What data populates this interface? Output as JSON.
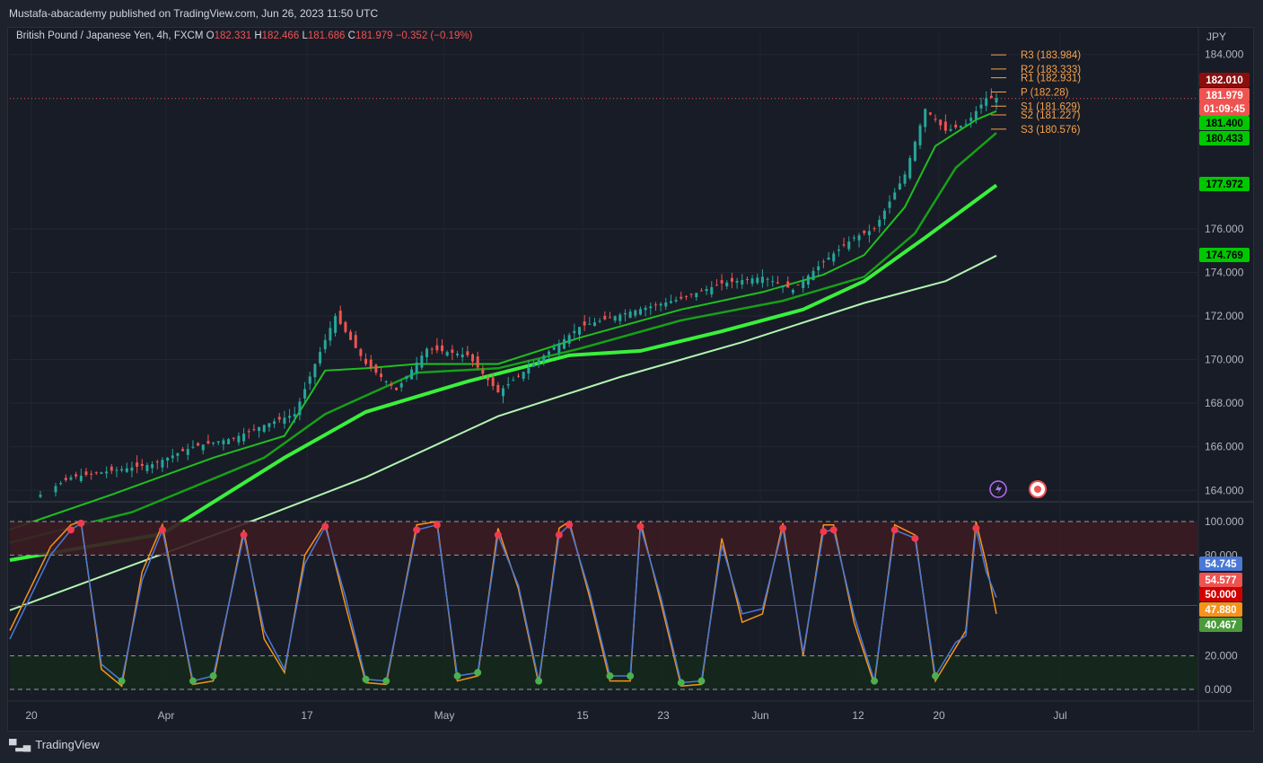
{
  "header": {
    "published": "Mustafa-abacademy published on TradingView.com, Jun 26, 2023 11:50 UTC"
  },
  "legend": {
    "symbol": "British Pound / Japanese Yen, 4h, FXCM",
    "o_label": "O",
    "o": "182.331",
    "h_label": "H",
    "h": "182.466",
    "l_label": "L",
    "l": "181.686",
    "c_label": "C",
    "c": "181.979",
    "change": "−0.352 (−0.19%)"
  },
  "footer": {
    "brand": "TradingView"
  },
  "colors": {
    "background": "#181c27",
    "up": "#26a69a",
    "down": "#ef5350",
    "ema_green": "#2fd62f",
    "sma_light": "#b2f5b2",
    "pivot": "#f7a24a",
    "stoch_k": "#4a79d6",
    "stoch_d": "#f7931a"
  },
  "chart_data": [
    {
      "type": "line",
      "title": "British Pound / Japanese Yen, 4h, FXCM",
      "currency_label": "JPY",
      "x_ticks": [
        "20",
        "Apr",
        "17",
        "May",
        "15",
        "23",
        "Jun",
        "12",
        "20",
        "Jul"
      ],
      "y_ticks": [
        "164.000",
        "166.000",
        "168.000",
        "170.000",
        "172.000",
        "174.000",
        "176.000",
        "184.000"
      ],
      "ylim": [
        163.6,
        184.4
      ],
      "price_labels": [
        {
          "value": "182.010",
          "color": "#8b0e0e"
        },
        {
          "value": "181.979",
          "color": "#ef5350"
        },
        {
          "value": "01:09:45",
          "color": "#ef5350"
        },
        {
          "value": "181.400",
          "color": "#00c800"
        },
        {
          "value": "180.433",
          "color": "#00c800"
        },
        {
          "value": "177.972",
          "color": "#00c800"
        },
        {
          "value": "174.769",
          "color": "#00c800"
        }
      ],
      "pivots": [
        {
          "label": "R3 (183.984)",
          "value": 183.984
        },
        {
          "label": "R2 (183.333)",
          "value": 183.333
        },
        {
          "label": "R1 (182.931)",
          "value": 182.931
        },
        {
          "label": "P (182.28)",
          "value": 182.28
        },
        {
          "label": "S1 (181.629)",
          "value": 181.629
        },
        {
          "label": "S2 (181.227)",
          "value": 181.227
        },
        {
          "label": "S3 (180.576)",
          "value": 180.576
        }
      ],
      "series": [
        {
          "values": [
            [
              0,
              163.0
            ],
            [
              6,
              164.6
            ],
            [
              14,
              165.2
            ],
            [
              18,
              166.0
            ],
            [
              22,
              166.4
            ],
            [
              25,
              167.0
            ],
            [
              28,
              167.5
            ],
            [
              30,
              169.8
            ],
            [
              32,
              172.0
            ],
            [
              35,
              169.8
            ],
            [
              38,
              168.6
            ],
            [
              41,
              170.5
            ],
            [
              45,
              170.2
            ],
            [
              48,
              168.5
            ],
            [
              52,
              170.0
            ],
            [
              56,
              171.5
            ],
            [
              61,
              172.2
            ],
            [
              66,
              172.8
            ],
            [
              70,
              173.5
            ],
            [
              74,
              173.8
            ],
            [
              77,
              173.2
            ],
            [
              80,
              174.5
            ],
            [
              83,
              175.6
            ],
            [
              85,
              176.0
            ],
            [
              88,
              178.5
            ],
            [
              90,
              181.5
            ],
            [
              92,
              180.5
            ],
            [
              94,
              180.8
            ],
            [
              96,
              182.0
            ],
            [
              97,
              182.0
            ]
          ]
        },
        {
          "values": [
            [
              0,
              162.2
            ],
            [
              10,
              163.8
            ],
            [
              20,
              165.5
            ],
            [
              27,
              166.5
            ],
            [
              31,
              169.5
            ],
            [
              35,
              169.6
            ],
            [
              40,
              169.8
            ],
            [
              48,
              169.8
            ],
            [
              56,
              171.0
            ],
            [
              66,
              172.3
            ],
            [
              74,
              173.1
            ],
            [
              80,
              173.9
            ],
            [
              84,
              174.8
            ],
            [
              88,
              177.0
            ],
            [
              91,
              179.8
            ],
            [
              95,
              181.0
            ],
            [
              97,
              181.4
            ]
          ]
        },
        {
          "values": [
            [
              0,
              161.6
            ],
            [
              12,
              163.0
            ],
            [
              25,
              165.5
            ],
            [
              31,
              167.5
            ],
            [
              40,
              169.4
            ],
            [
              48,
              169.6
            ],
            [
              56,
              170.5
            ],
            [
              66,
              171.8
            ],
            [
              76,
              172.7
            ],
            [
              84,
              173.8
            ],
            [
              89,
              175.8
            ],
            [
              93,
              178.8
            ],
            [
              97,
              180.4
            ]
          ]
        },
        {
          "values": [
            [
              0,
              160.8
            ],
            [
              15,
              162.0
            ],
            [
              27,
              165.5
            ],
            [
              35,
              167.6
            ],
            [
              45,
              169.0
            ],
            [
              55,
              170.2
            ],
            [
              62,
              170.4
            ],
            [
              70,
              171.3
            ],
            [
              78,
              172.3
            ],
            [
              84,
              173.6
            ],
            [
              90,
              175.6
            ],
            [
              97,
              178.0
            ]
          ]
        },
        {
          "values": [
            [
              0,
              158.5
            ],
            [
              25,
              162.8
            ],
            [
              35,
              164.6
            ],
            [
              48,
              167.4
            ],
            [
              60,
              169.2
            ],
            [
              72,
              170.8
            ],
            [
              84,
              172.6
            ],
            [
              92,
              173.6
            ],
            [
              97,
              174.77
            ]
          ]
        }
      ]
    },
    {
      "type": "line",
      "title": "",
      "y_ticks": [
        "0.000",
        "20.000",
        "80.000",
        "100.000"
      ],
      "ylim": [
        0,
        100
      ],
      "overbought": 80,
      "oversold": 20,
      "midline": 50,
      "value_labels": [
        {
          "value": "54.745",
          "color": "#4a79d6"
        },
        {
          "value": "54.577",
          "color": "#ef5350"
        },
        {
          "value": "50.000",
          "color": "#d10000"
        },
        {
          "value": "47.880",
          "color": "#f7931a"
        },
        {
          "value": "40.467",
          "color": "#4a9b3b"
        }
      ],
      "series": [
        {
          "values": [
            [
              0,
              35
            ],
            [
              2,
              60
            ],
            [
              4,
              85
            ],
            [
              6,
              98
            ],
            [
              7,
              100
            ],
            [
              9,
              12
            ],
            [
              11,
              2
            ],
            [
              13,
              70
            ],
            [
              15,
              98
            ],
            [
              18,
              3
            ],
            [
              20,
              5
            ],
            [
              23,
              95
            ],
            [
              25,
              30
            ],
            [
              27,
              10
            ],
            [
              29,
              80
            ],
            [
              31,
              99
            ],
            [
              33,
              50
            ],
            [
              35,
              4
            ],
            [
              37,
              3
            ],
            [
              40,
              98
            ],
            [
              42,
              100
            ],
            [
              44,
              5
            ],
            [
              46,
              8
            ],
            [
              48,
              96
            ],
            [
              50,
              60
            ],
            [
              52,
              3
            ],
            [
              54,
              96
            ],
            [
              55,
              100
            ],
            [
              57,
              55
            ],
            [
              59,
              5
            ],
            [
              61,
              5
            ],
            [
              62,
              100
            ],
            [
              64,
              52
            ],
            [
              66,
              2
            ],
            [
              68,
              3
            ],
            [
              70,
              90
            ],
            [
              72,
              40
            ],
            [
              74,
              45
            ],
            [
              76,
              99
            ],
            [
              78,
              20
            ],
            [
              80,
              98
            ],
            [
              81,
              98
            ],
            [
              83,
              40
            ],
            [
              85,
              3
            ],
            [
              87,
              98
            ],
            [
              89,
              92
            ],
            [
              91,
              5
            ],
            [
              93,
              25
            ],
            [
              94,
              35
            ],
            [
              95,
              100
            ],
            [
              96,
              75
            ],
            [
              97,
              45
            ]
          ]
        },
        {
          "values": [
            [
              0,
              30
            ],
            [
              2,
              55
            ],
            [
              4,
              80
            ],
            [
              6,
              95
            ],
            [
              7,
              99
            ],
            [
              9,
              15
            ],
            [
              11,
              5
            ],
            [
              13,
              65
            ],
            [
              15,
              95
            ],
            [
              18,
              5
            ],
            [
              20,
              8
            ],
            [
              23,
              92
            ],
            [
              25,
              35
            ],
            [
              27,
              12
            ],
            [
              29,
              75
            ],
            [
              31,
              97
            ],
            [
              33,
              55
            ],
            [
              35,
              6
            ],
            [
              37,
              5
            ],
            [
              40,
              95
            ],
            [
              42,
              98
            ],
            [
              44,
              8
            ],
            [
              46,
              10
            ],
            [
              48,
              92
            ],
            [
              50,
              62
            ],
            [
              52,
              5
            ],
            [
              54,
              92
            ],
            [
              55,
              98
            ],
            [
              57,
              58
            ],
            [
              59,
              8
            ],
            [
              61,
              8
            ],
            [
              62,
              97
            ],
            [
              64,
              55
            ],
            [
              66,
              4
            ],
            [
              68,
              5
            ],
            [
              70,
              86
            ],
            [
              72,
              45
            ],
            [
              74,
              48
            ],
            [
              76,
              96
            ],
            [
              78,
              22
            ],
            [
              80,
              94
            ],
            [
              81,
              95
            ],
            [
              83,
              44
            ],
            [
              85,
              5
            ],
            [
              87,
              95
            ],
            [
              89,
              90
            ],
            [
              91,
              8
            ],
            [
              93,
              28
            ],
            [
              94,
              32
            ],
            [
              95,
              96
            ],
            [
              96,
              70
            ],
            [
              97,
              54.7
            ]
          ]
        }
      ]
    }
  ]
}
